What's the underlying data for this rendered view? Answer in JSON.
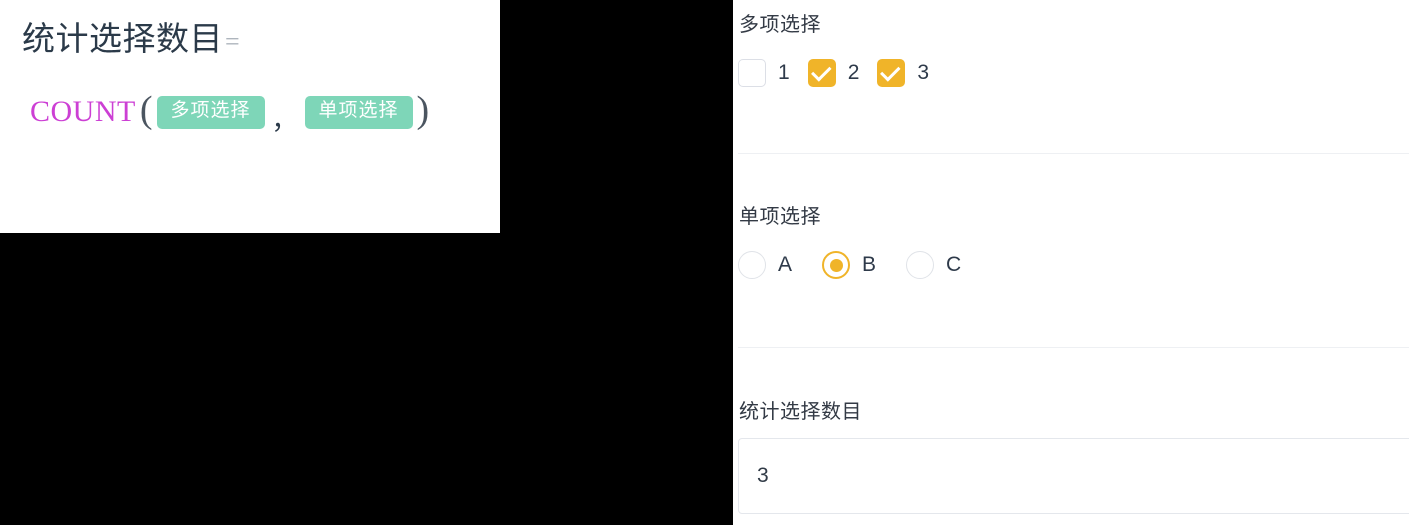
{
  "formula_preview": {
    "title": "统计选择数目",
    "equals_sign": "=",
    "function_name": "COUNT",
    "open_paren": "(",
    "close_paren": ")",
    "separator": "，",
    "arguments": [
      {
        "label": "多项选择"
      },
      {
        "label": "单项选择"
      }
    ],
    "colors": {
      "chip_background": "#7ed6b8",
      "function_name": "#cc3fd4",
      "title": "#2b3a49"
    }
  },
  "form": {
    "accent_color": "#f0b429",
    "fields": [
      {
        "name": "multi-select",
        "label": "多项选择",
        "type": "checkbox-group",
        "options": [
          {
            "label": "1",
            "checked": false
          },
          {
            "label": "2",
            "checked": true
          },
          {
            "label": "3",
            "checked": true
          }
        ]
      },
      {
        "name": "single-select",
        "label": "单项选择",
        "type": "radio-group",
        "options": [
          {
            "label": "A",
            "checked": false
          },
          {
            "label": "B",
            "checked": true
          },
          {
            "label": "C",
            "checked": false
          }
        ]
      },
      {
        "name": "count-result",
        "label": "统计选择数目",
        "type": "text",
        "value": "3",
        "placeholder": ""
      }
    ]
  }
}
